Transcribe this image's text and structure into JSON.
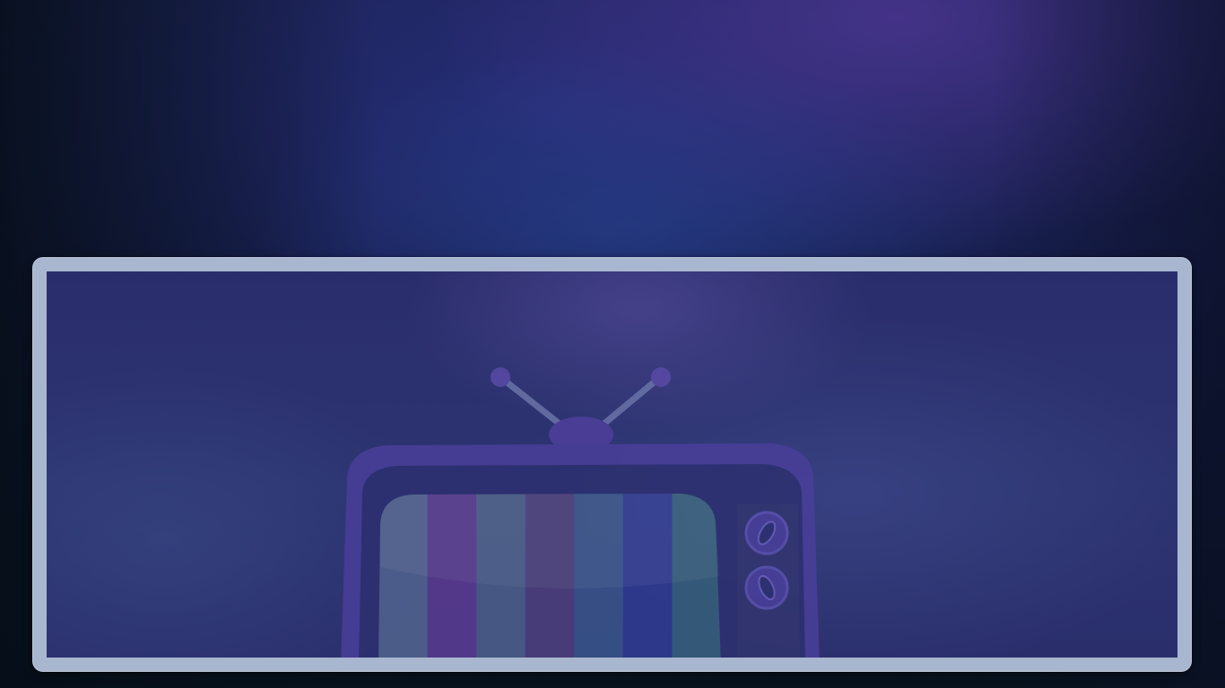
{
  "scene": {
    "background_colors": {
      "top": "#171d45",
      "glow_blue": "#284696",
      "glow_purple": "#503796",
      "bottom": "#07121c"
    },
    "frame_color": "#a9b6cf",
    "screen_color": "#2c3470"
  },
  "tv": {
    "icon": "retro-tv-icon",
    "body_color": "#4a3f9a",
    "screen_stripe_colors": [
      "#52648f",
      "#5a3a8e",
      "#4a5e86",
      "#4d3f7a",
      "#385488",
      "#2e3a90",
      "#36607a"
    ],
    "knob_icons": [
      "volume-knob-icon",
      "channel-knob-icon"
    ]
  }
}
